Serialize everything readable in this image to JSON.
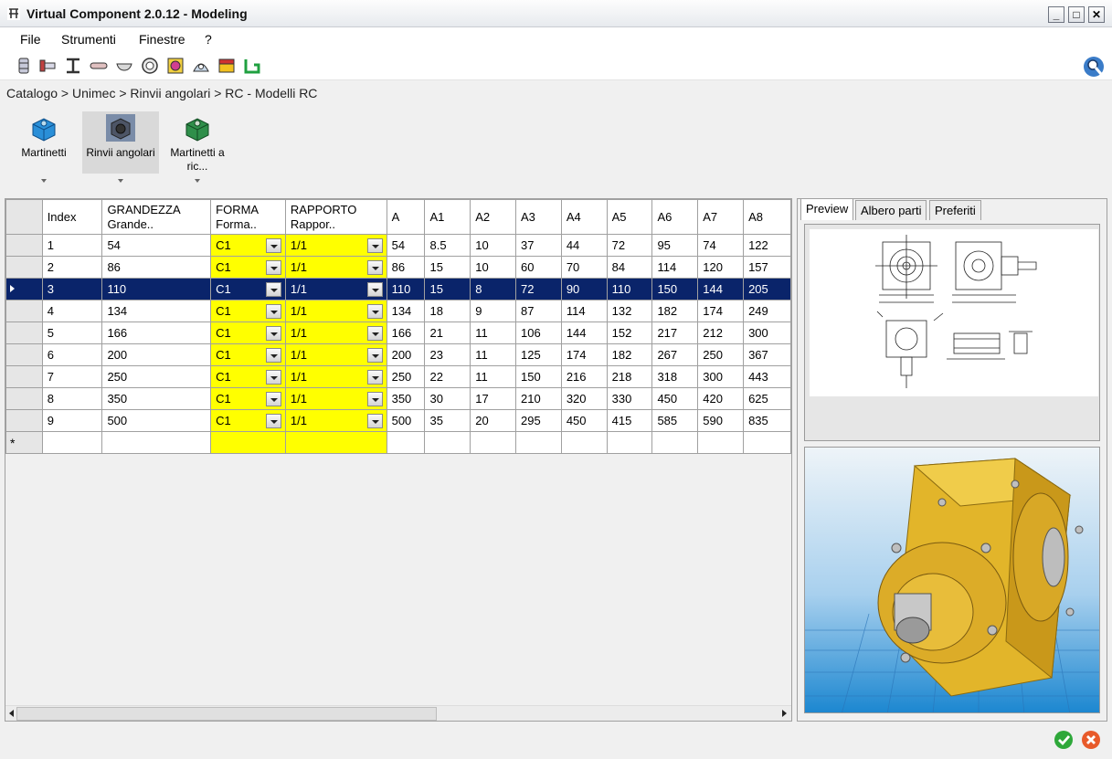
{
  "window": {
    "title": "Virtual Component 2.0.12 - Modeling",
    "minimize_glyph": "_",
    "maximize_glyph": "□",
    "close_glyph": "✕"
  },
  "menu": [
    "File",
    "Strumenti",
    "Finestre",
    "?"
  ],
  "toolbar_icons": [
    "bolt-icon",
    "screw-icon",
    "beam-icon",
    "pin-icon",
    "washer-icon",
    "ring-icon",
    "bearing-icon",
    "bracket-icon",
    "block-icon",
    "profile-icon"
  ],
  "breadcrumb": "Catalogo > Unimec > Rinvii angolari > RC - Modelli RC",
  "categories": [
    {
      "label": "Martinetti",
      "icon": "jack-icon",
      "color": "#2a8fd8"
    },
    {
      "label": "Rinvii angolari",
      "icon": "gearbox-icon",
      "color": "#4d5566"
    },
    {
      "label": "Martinetti a ric...",
      "icon": "jack-ric-icon",
      "color": "#2f8f4a"
    }
  ],
  "grid": {
    "columns": [
      {
        "h1": "Index",
        "h2": ""
      },
      {
        "h1": "GRANDEZZA",
        "h2": "Grande.."
      },
      {
        "h1": "FORMA",
        "h2": "Forma.."
      },
      {
        "h1": "RAPPORTO",
        "h2": "Rappor.."
      },
      {
        "h1": "A",
        "h2": ""
      },
      {
        "h1": "A1",
        "h2": ""
      },
      {
        "h1": "A2",
        "h2": ""
      },
      {
        "h1": "A3",
        "h2": ""
      },
      {
        "h1": "A4",
        "h2": ""
      },
      {
        "h1": "A5",
        "h2": ""
      },
      {
        "h1": "A6",
        "h2": ""
      },
      {
        "h1": "A7",
        "h2": ""
      },
      {
        "h1": "A8",
        "h2": ""
      }
    ],
    "selected_row": 2,
    "new_row_marker": "*",
    "rows": [
      [
        "1",
        "54",
        "C1",
        "1/1",
        "54",
        "8.5",
        "10",
        "37",
        "44",
        "72",
        "95",
        "74",
        "122"
      ],
      [
        "2",
        "86",
        "C1",
        "1/1",
        "86",
        "15",
        "10",
        "60",
        "70",
        "84",
        "114",
        "120",
        "157"
      ],
      [
        "3",
        "110",
        "C1",
        "1/1",
        "110",
        "15",
        "8",
        "72",
        "90",
        "110",
        "150",
        "144",
        "205"
      ],
      [
        "4",
        "134",
        "C1",
        "1/1",
        "134",
        "18",
        "9",
        "87",
        "114",
        "132",
        "182",
        "174",
        "249"
      ],
      [
        "5",
        "166",
        "C1",
        "1/1",
        "166",
        "21",
        "11",
        "106",
        "144",
        "152",
        "217",
        "212",
        "300"
      ],
      [
        "6",
        "200",
        "C1",
        "1/1",
        "200",
        "23",
        "11",
        "125",
        "174",
        "182",
        "267",
        "250",
        "367"
      ],
      [
        "7",
        "250",
        "C1",
        "1/1",
        "250",
        "22",
        "11",
        "150",
        "216",
        "218",
        "318",
        "300",
        "443"
      ],
      [
        "8",
        "350",
        "C1",
        "1/1",
        "350",
        "30",
        "17",
        "210",
        "320",
        "330",
        "450",
        "420",
        "625"
      ],
      [
        "9",
        "500",
        "C1",
        "1/1",
        "500",
        "35",
        "20",
        "295",
        "450",
        "415",
        "585",
        "590",
        "835"
      ]
    ]
  },
  "tabs": [
    "Preview",
    "Albero parti",
    "Preferiti"
  ],
  "active_tab": 0,
  "colors": {
    "selection": "#0a246a",
    "editable_cell": "#ffff00",
    "model_body": "#e2b52a"
  }
}
